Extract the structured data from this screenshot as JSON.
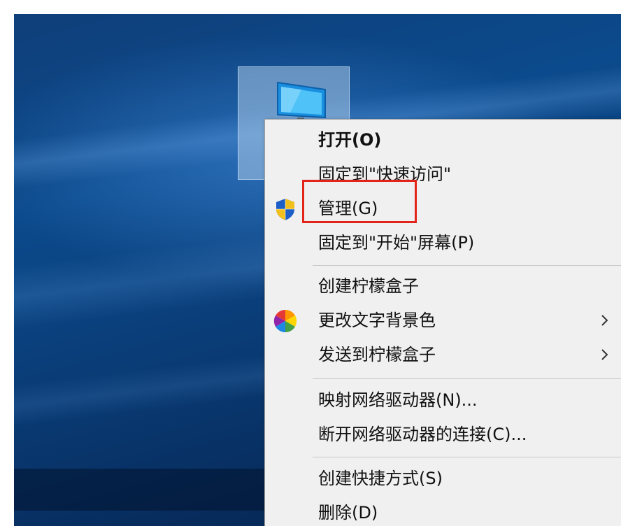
{
  "colors": {
    "highlight": "#e3241b",
    "menu_background": "#f0f0f0",
    "desktop_blue": "#0b4a8c"
  },
  "desktop": {
    "selected_icon": "this-pc-icon"
  },
  "context_menu": {
    "items": [
      {
        "label": "打开(O)",
        "icon": null,
        "submenu": false,
        "bold": true
      },
      {
        "label": "固定到\"快速访问\"",
        "icon": null,
        "submenu": false
      },
      {
        "label": "管理(G)",
        "icon": "uac-shield-icon",
        "submenu": false,
        "highlighted": true
      },
      {
        "label": "固定到\"开始\"屏幕(P)",
        "icon": null,
        "submenu": false
      },
      {
        "label": "创建柠檬盒子",
        "icon": null,
        "submenu": false
      },
      {
        "label": "更改文字背景色",
        "icon": "color-wheel-icon",
        "submenu": true
      },
      {
        "label": "发送到柠檬盒子",
        "icon": null,
        "submenu": true
      },
      {
        "label": "映射网络驱动器(N)...",
        "icon": null,
        "submenu": false
      },
      {
        "label": "断开网络驱动器的连接(C)...",
        "icon": null,
        "submenu": false
      },
      {
        "label": "创建快捷方式(S)",
        "icon": null,
        "submenu": false
      },
      {
        "label": "删除(D)",
        "icon": null,
        "submenu": false
      }
    ]
  }
}
